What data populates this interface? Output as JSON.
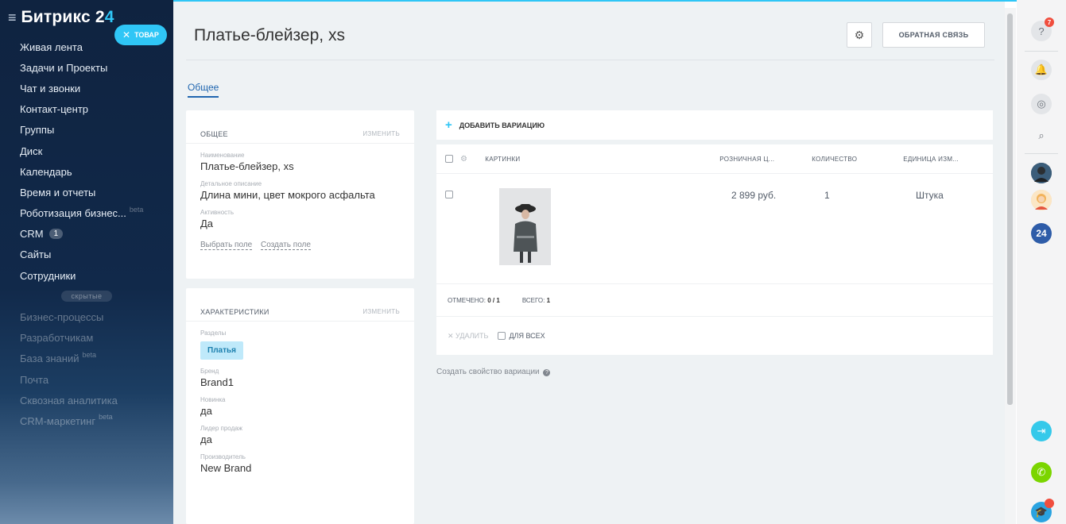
{
  "sidebar": {
    "logo": "Битрикс 2",
    "logo_suffix": "4",
    "badge_label": "товар",
    "items": [
      {
        "label": "Живая лента"
      },
      {
        "label": "Задачи и Проекты"
      },
      {
        "label": "Чат и звонки"
      },
      {
        "label": "Контакт-центр"
      },
      {
        "label": "Группы"
      },
      {
        "label": "Диск"
      },
      {
        "label": "Календарь"
      },
      {
        "label": "Время и отчеты"
      },
      {
        "label": "Роботизация бизнес...",
        "beta": "beta"
      },
      {
        "label": "CRM",
        "counter": "1"
      },
      {
        "label": "Сайты"
      },
      {
        "label": "Сотрудники"
      }
    ],
    "hidden_label": "скрытые",
    "dim_items": [
      {
        "label": "Бизнес-процессы"
      },
      {
        "label": "Разработчикам"
      },
      {
        "label": "База знаний",
        "beta": "beta"
      },
      {
        "label": "Почта"
      },
      {
        "label": "Сквозная аналитика"
      },
      {
        "label": "CRM-маркетинг",
        "beta": "beta"
      }
    ]
  },
  "header": {
    "title": "Платье-блейзер, xs",
    "feedback_label": "Обратная связь",
    "tab_label": "Общее"
  },
  "general_card": {
    "title": "Общее",
    "edit_label": "изменить",
    "fields": [
      {
        "label": "Наименование",
        "value": "Платье-блейзер, xs"
      },
      {
        "label": "Детальное описание",
        "value": "Длина мини, цвет мокрого асфальта"
      },
      {
        "label": "Активность",
        "value": "Да"
      }
    ],
    "link_select": "Выбрать поле",
    "link_create": "Создать поле"
  },
  "chars_card": {
    "title": "Характеристики",
    "edit_label": "изменить",
    "section_label": "Разделы",
    "section_tag": "Платья",
    "fields": [
      {
        "label": "Бренд",
        "value": "Brand1"
      },
      {
        "label": "Новинка",
        "value": "да"
      },
      {
        "label": "Лидер продаж",
        "value": "да"
      },
      {
        "label": "Производитель",
        "value": "New Brand"
      }
    ]
  },
  "variations": {
    "add_label": "Добавить вариацию",
    "columns": [
      "Картинки",
      "Розничная ц...",
      "Количество",
      "Единица изм..."
    ],
    "rows": [
      {
        "price": "2 899 руб.",
        "quantity": "1",
        "unit": "Штука"
      }
    ],
    "selected_label": "Отмечено:",
    "selected_value": "0 / 1",
    "total_label": "Всего:",
    "total_value": "1",
    "delete_label": "Удалить",
    "for_all_label": "Для всех",
    "create_prop_label": "Создать свойство вариации"
  },
  "rail": {
    "help_badge": "7",
    "avatar_count": "24"
  },
  "colors": {
    "accent": "#2fc6f6",
    "link": "#2066b0",
    "sidebar_bg": "#0f2340",
    "main_bg": "#eef2f4"
  }
}
